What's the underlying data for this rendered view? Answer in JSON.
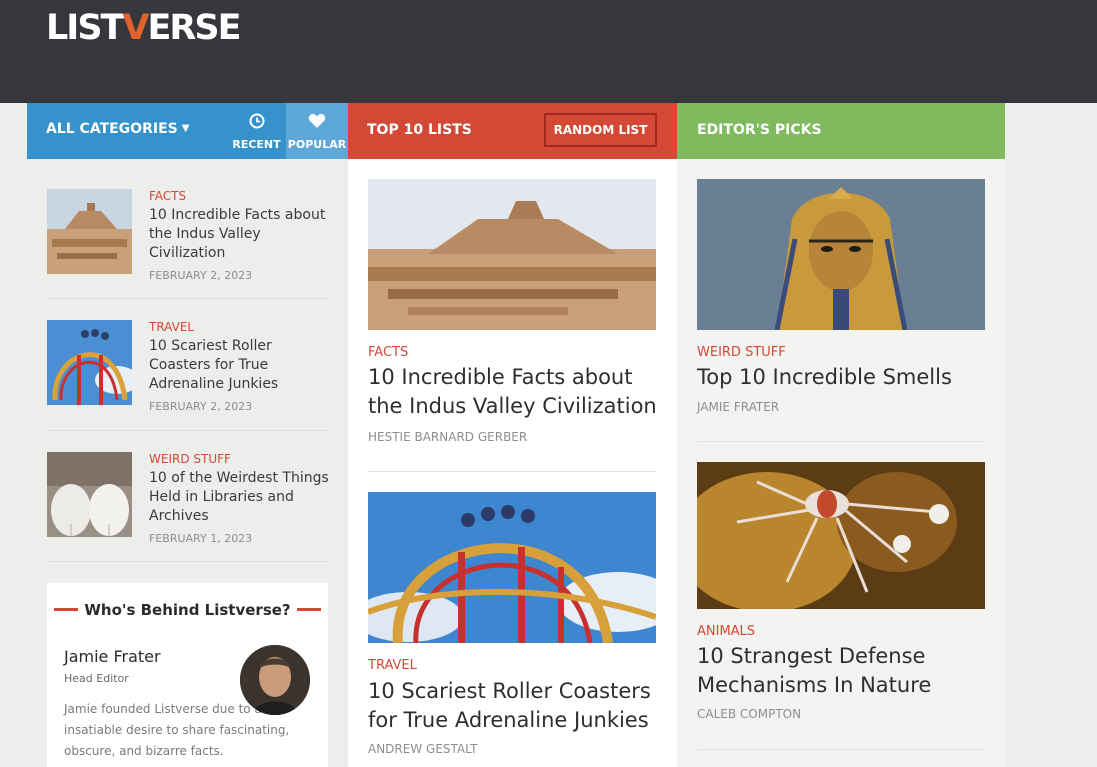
{
  "logo": {
    "text_a": "LIST",
    "text_v": "V",
    "text_b": "ERSE"
  },
  "nav": {
    "all_categories": "ALL CATEGORIES",
    "recent": "RECENT",
    "popular": "POPULAR",
    "top10": "TOP 10 LISTS",
    "random": "RANDOM LIST",
    "editors_picks": "EDITOR'S PICKS"
  },
  "colors": {
    "blue": "#3592cb",
    "red": "#d44936",
    "green": "#7fbb5e",
    "header": "#35373c"
  },
  "left_list": [
    {
      "category": "FACTS",
      "title": "10 Incredible Facts about the Indus Valley Civilization",
      "date": "FEBRUARY 2, 2023"
    },
    {
      "category": "TRAVEL",
      "title": "10 Scariest Roller Coasters for True Adrenaline Junkies",
      "date": "FEBRUARY 2, 2023"
    },
    {
      "category": "WEIRD STUFF",
      "title": "10 of the Weirdest Things Held in Libraries and Archives",
      "date": "FEBRUARY 1, 2023"
    }
  ],
  "who": {
    "heading": "Who's Behind Listverse?",
    "name": "Jamie Frater",
    "role": "Head Editor",
    "bio": "Jamie founded Listverse due to an insatiable desire to share fascinating, obscure, and bizarre facts."
  },
  "top10": [
    {
      "category": "FACTS",
      "title": "10 Incredible Facts about the Indus Valley Civilization",
      "author": "HESTIE BARNARD GERBER"
    },
    {
      "category": "TRAVEL",
      "title": "10 Scariest Roller Coasters for True Adrenaline Junkies",
      "author": "ANDREW GESTALT"
    }
  ],
  "picks": [
    {
      "category": "WEIRD STUFF",
      "title": "Top 10 Incredible Smells",
      "author": "JAMIE FRATER"
    },
    {
      "category": "ANIMALS",
      "title": "10 Strangest Defense Mechanisms In Nature",
      "author": "CALEB COMPTON"
    }
  ]
}
